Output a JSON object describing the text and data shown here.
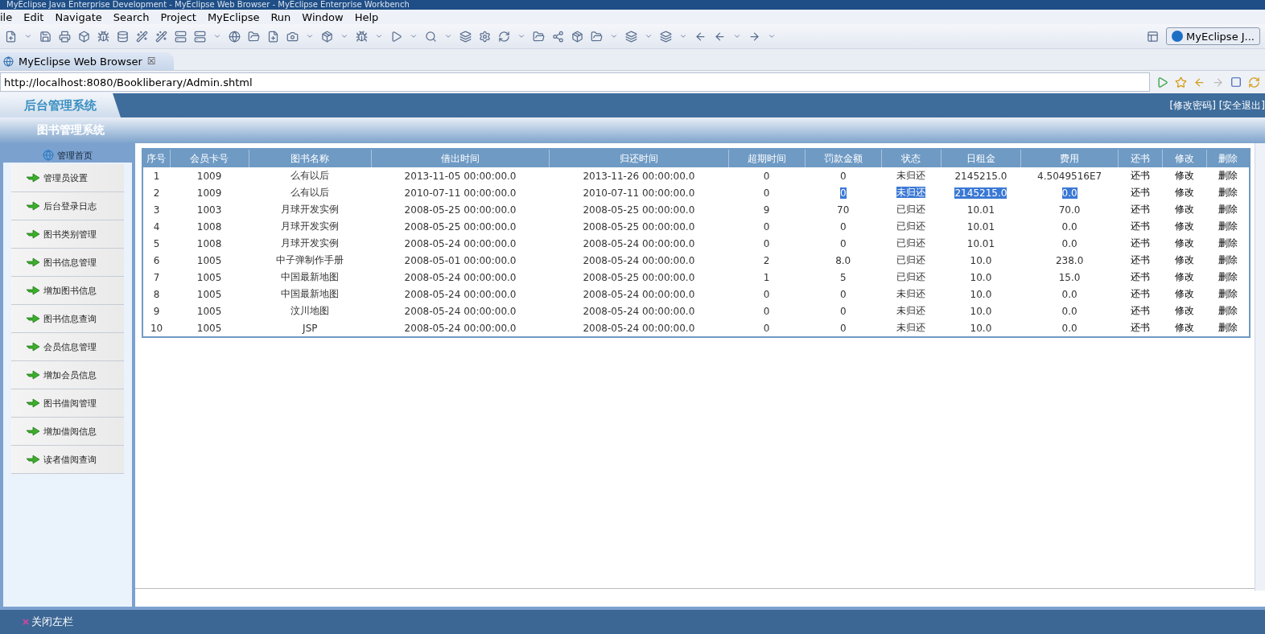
{
  "window": {
    "title": "MyEclipse Java Enterprise Development - MyEclipse Web Browser - MyEclipse Enterprise Workbench"
  },
  "menu": [
    "ile",
    "Edit",
    "Navigate",
    "Search",
    "Project",
    "MyEclipse",
    "Run",
    "Window",
    "Help"
  ],
  "perspective": {
    "label": "MyEclipse J..."
  },
  "editor_tab": {
    "label": "MyEclipse Web Browser",
    "close": "☒"
  },
  "browser": {
    "url": "http://localhost:8080/Bookliberary/Admin.shtml"
  },
  "page": {
    "logo": "后台管理系统",
    "top_links": "[修改密码] [安全退出]",
    "system_title": "图书管理系统",
    "sidebar": {
      "home": "管理首页",
      "items": [
        "管理员设置",
        "后台登录日志",
        "图书类别管理",
        "图书信息管理",
        "增加图书信息",
        "图书信息查询",
        "会员信息管理",
        "增加会员信息",
        "图书借阅管理",
        "增加借阅信息",
        "读者借阅查询"
      ]
    },
    "table": {
      "columns": [
        {
          "label": "序号",
          "kind": "text"
        },
        {
          "label": "会员卡号",
          "kind": "text"
        },
        {
          "label": "图书名称",
          "kind": "text"
        },
        {
          "label": "借出时间",
          "kind": "text"
        },
        {
          "label": "归还时间",
          "kind": "text"
        },
        {
          "label": "超期时间",
          "kind": "text"
        },
        {
          "label": "罚款金额",
          "kind": "text"
        },
        {
          "label": "状态",
          "kind": "text"
        },
        {
          "label": "日租金",
          "kind": "text"
        },
        {
          "label": "费用",
          "kind": "text"
        },
        {
          "label": "还书",
          "kind": "link"
        },
        {
          "label": "修改",
          "kind": "link"
        },
        {
          "label": "删除",
          "kind": "link"
        }
      ],
      "rows": [
        {
          "cells": [
            "1",
            "1009",
            "么有以后",
            "2013-11-05 00:00:00.0",
            "2013-11-26 00:00:00.0",
            "0",
            "0",
            "未归还",
            "2145215.0",
            "4.5049516E7",
            "还书",
            "修改",
            "删除"
          ],
          "highlighted": [
            false,
            false,
            false,
            false,
            false,
            false,
            false,
            false,
            false,
            false,
            false,
            false,
            false
          ]
        },
        {
          "cells": [
            "2",
            "1009",
            "么有以后",
            "2010-07-11 00:00:00.0",
            "2010-07-11 00:00:00.0",
            "0",
            "0",
            "未归还",
            "2145215.0",
            "0.0",
            "还书",
            "修改",
            "删除"
          ],
          "highlighted": [
            false,
            false,
            false,
            false,
            false,
            false,
            true,
            true,
            true,
            true,
            false,
            false,
            false
          ]
        },
        {
          "cells": [
            "3",
            "1003",
            "月球开发实例",
            "2008-05-25 00:00:00.0",
            "2008-05-25 00:00:00.0",
            "9",
            "70",
            "已归还",
            "10.01",
            "70.0",
            "还书",
            "修改",
            "删除"
          ],
          "highlighted": [
            false,
            false,
            false,
            false,
            false,
            false,
            false,
            false,
            false,
            false,
            false,
            false,
            false
          ]
        },
        {
          "cells": [
            "4",
            "1008",
            "月球开发实例",
            "2008-05-25 00:00:00.0",
            "2008-05-25 00:00:00.0",
            "0",
            "0",
            "已归还",
            "10.01",
            "0.0",
            "还书",
            "修改",
            "删除"
          ],
          "highlighted": [
            false,
            false,
            false,
            false,
            false,
            false,
            false,
            false,
            false,
            false,
            false,
            false,
            false
          ]
        },
        {
          "cells": [
            "5",
            "1008",
            "月球开发实例",
            "2008-05-24 00:00:00.0",
            "2008-05-24 00:00:00.0",
            "0",
            "0",
            "已归还",
            "10.01",
            "0.0",
            "还书",
            "修改",
            "删除"
          ],
          "highlighted": [
            false,
            false,
            false,
            false,
            false,
            false,
            false,
            false,
            false,
            false,
            false,
            false,
            false
          ]
        },
        {
          "cells": [
            "6",
            "1005",
            "中子弹制作手册",
            "2008-05-01 00:00:00.0",
            "2008-05-24 00:00:00.0",
            "2",
            "8.0",
            "已归还",
            "10.0",
            "238.0",
            "还书",
            "修改",
            "删除"
          ],
          "highlighted": [
            false,
            false,
            false,
            false,
            false,
            false,
            false,
            false,
            false,
            false,
            false,
            false,
            false
          ]
        },
        {
          "cells": [
            "7",
            "1005",
            "中国最新地图",
            "2008-05-24 00:00:00.0",
            "2008-05-25 00:00:00.0",
            "1",
            "5",
            "已归还",
            "10.0",
            "15.0",
            "还书",
            "修改",
            "删除"
          ],
          "highlighted": [
            false,
            false,
            false,
            false,
            false,
            false,
            false,
            false,
            false,
            false,
            false,
            false,
            false
          ]
        },
        {
          "cells": [
            "8",
            "1005",
            "中国最新地图",
            "2008-05-24 00:00:00.0",
            "2008-05-24 00:00:00.0",
            "0",
            "0",
            "未归还",
            "10.0",
            "0.0",
            "还书",
            "修改",
            "删除"
          ],
          "highlighted": [
            false,
            false,
            false,
            false,
            false,
            false,
            false,
            false,
            false,
            false,
            false,
            false,
            false
          ]
        },
        {
          "cells": [
            "9",
            "1005",
            "汶川地图",
            "2008-05-24 00:00:00.0",
            "2008-05-24 00:00:00.0",
            "0",
            "0",
            "未归还",
            "10.0",
            "0.0",
            "还书",
            "修改",
            "删除"
          ],
          "highlighted": [
            false,
            false,
            false,
            false,
            false,
            false,
            false,
            false,
            false,
            false,
            false,
            false,
            false
          ]
        },
        {
          "cells": [
            "10",
            "1005",
            "JSP",
            "2008-05-24 00:00:00.0",
            "2008-05-24 00:00:00.0",
            "0",
            "0",
            "未归还",
            "10.0",
            "0.0",
            "还书",
            "修改",
            "删除"
          ],
          "highlighted": [
            false,
            false,
            false,
            false,
            false,
            false,
            false,
            false,
            false,
            false,
            false,
            false,
            false
          ]
        }
      ]
    },
    "footer": {
      "close_sidebar": "关闭左栏"
    }
  }
}
